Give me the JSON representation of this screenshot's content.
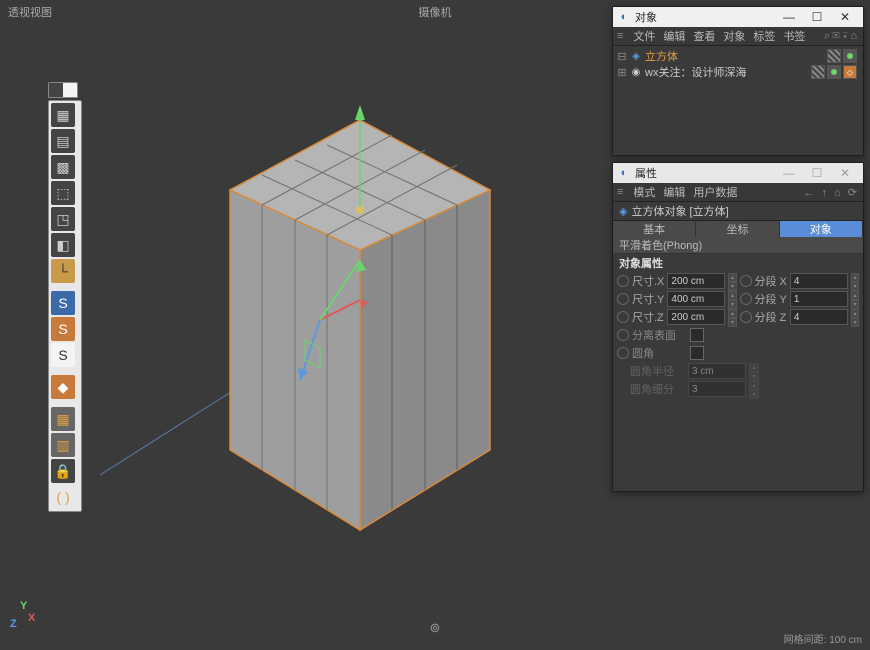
{
  "viewport": {
    "label_left": "透视视图",
    "label_center": "摄像机",
    "grid_info": "网格间距: 100 cm"
  },
  "axis": {
    "x": "X",
    "y": "Y",
    "z": "Z"
  },
  "panels": {
    "objects": {
      "title": "对象",
      "menu": [
        "文件",
        "编辑",
        "查看",
        "对象",
        "标签",
        "书签"
      ],
      "tree": [
        {
          "name": "立方体",
          "tags": [
            "checker",
            "green"
          ]
        },
        {
          "name": "wx关注：设计师深海",
          "tags": [
            "checker",
            "green",
            "orange"
          ]
        }
      ]
    },
    "attrs": {
      "title": "属性",
      "menu": [
        "模式",
        "编辑",
        "用户数据"
      ],
      "object_label": "立方体对象 [立方体]",
      "tabs": [
        "基本",
        "坐标",
        "对象"
      ],
      "subrow": "平滑着色(Phong)",
      "section": "对象属性",
      "props": {
        "sizeX_lbl": "尺寸.X",
        "sizeX_val": "200 cm",
        "segX_lbl": "分段 X",
        "segX_val": "4",
        "sizeY_lbl": "尺寸.Y",
        "sizeY_val": "400 cm",
        "segY_lbl": "分段 Y",
        "segY_val": "1",
        "sizeZ_lbl": "尺寸.Z",
        "sizeZ_val": "200 cm",
        "segZ_lbl": "分段 Z",
        "segZ_val": "4",
        "sep_lbl": "分离表面",
        "fillet_lbl": "圆角",
        "filletR_lbl": "圆角半径",
        "filletR_val": "3 cm",
        "filletSeg_lbl": "圆角细分",
        "filletSeg_val": "3"
      }
    }
  }
}
